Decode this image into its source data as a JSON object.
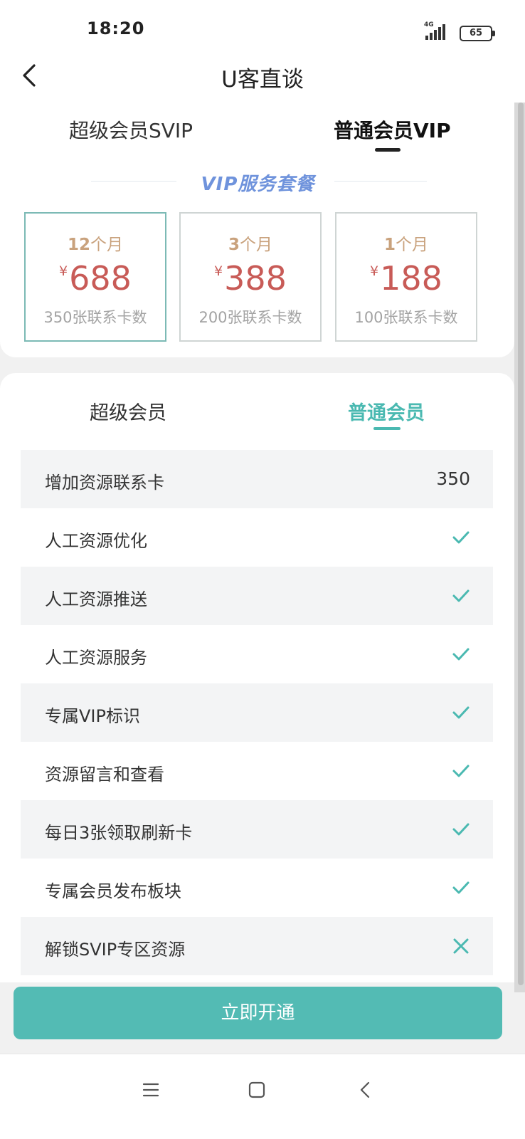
{
  "status": {
    "time": "18:20",
    "network": "4G",
    "battery": "65"
  },
  "nav": {
    "title": "U客直谈",
    "back_icon": "chevron-left-icon"
  },
  "top_tabs": [
    {
      "label": "超级会员SVIP",
      "active": false
    },
    {
      "label": "普通会员VIP",
      "active": true
    }
  ],
  "banner": {
    "title": "VIP服务套餐",
    "color": "#6f93dc"
  },
  "packages": [
    {
      "period_num": "12",
      "period_unit": "个月",
      "currency": "¥",
      "price": "688",
      "cards": "350张联系卡数",
      "selected": true
    },
    {
      "period_num": "3",
      "period_unit": "个月",
      "currency": "¥",
      "price": "388",
      "cards": "200张联系卡数",
      "selected": false
    },
    {
      "period_num": "1",
      "period_unit": "个月",
      "currency": "¥",
      "price": "188",
      "cards": "100张联系卡数",
      "selected": false
    }
  ],
  "member_tabs": [
    {
      "label": "超级会员",
      "active": false
    },
    {
      "label": "普通会员",
      "active": true
    }
  ],
  "features": [
    {
      "label": "增加资源联系卡",
      "value": "350"
    },
    {
      "label": "人工资源优化",
      "status": "check"
    },
    {
      "label": "人工资源推送",
      "status": "check"
    },
    {
      "label": "人工资源服务",
      "status": "check"
    },
    {
      "label": "专属VIP标识",
      "status": "check"
    },
    {
      "label": "资源留言和查看",
      "status": "check"
    },
    {
      "label": "每日3张领取刷新卡",
      "status": "check"
    },
    {
      "label": "专属会员发布板块",
      "status": "check"
    },
    {
      "label": "解锁SVIP专区资源",
      "status": "cross"
    }
  ],
  "cta": {
    "label": "立即开通",
    "color": "#53bbb4"
  },
  "accent": "#4ab9b1",
  "price_color": "#c85b57",
  "system_nav": {
    "menu_icon": "menu-icon",
    "home_icon": "home-square-icon",
    "back_icon": "back-triangle-icon"
  }
}
